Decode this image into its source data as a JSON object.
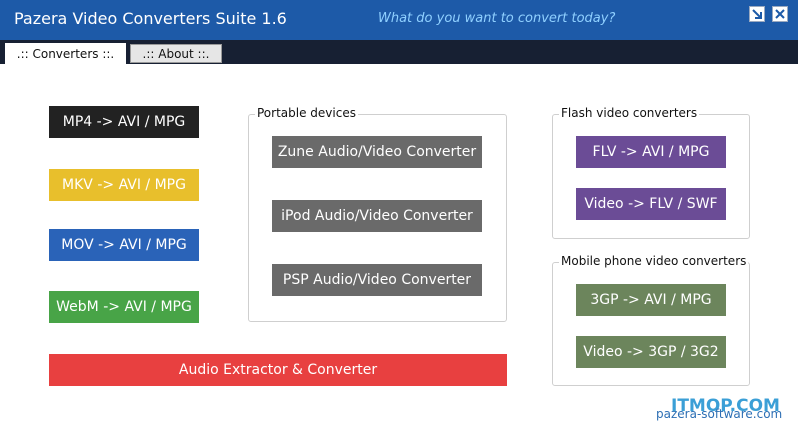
{
  "window": {
    "title": "Pazera Video Converters Suite 1.6",
    "tagline": "What do you want to convert today?",
    "controls": {
      "restore_icon": "restore-icon",
      "close_icon": "close-icon"
    }
  },
  "tabs": [
    {
      "label": ".:: Converters ::.",
      "active": true
    },
    {
      "label": ".:: About ::.",
      "active": false
    }
  ],
  "converters": {
    "mp4": "MP4 -> AVI / MPG",
    "mkv": "MKV -> AVI / MPG",
    "mov": "MOV -> AVI / MPG",
    "webm": "WebM -> AVI / MPG",
    "audio": "Audio Extractor & Converter"
  },
  "portable": {
    "label": "Portable devices",
    "zune": "Zune Audio/Video Converter",
    "ipod": "iPod Audio/Video Converter",
    "psp": "PSP Audio/Video Converter"
  },
  "flash": {
    "label": "Flash video converters",
    "flv": "FLV -> AVI / MPG",
    "video_flv": "Video -> FLV / SWF"
  },
  "mobile": {
    "label": "Mobile phone video converters",
    "three_gp": "3GP -> AVI / MPG",
    "video_3gp": "Video -> 3GP / 3G2"
  },
  "footer": {
    "link": "pazera-software.com"
  },
  "watermark": {
    "text": "ITMOP.COM"
  },
  "colors": {
    "titlebar": "#1d5aa8",
    "tabstrip": "#172033",
    "mp4": "#222222",
    "mkv": "#e8bf2c",
    "mov": "#2a63b8",
    "webm": "#48a447",
    "audio": "#e84040",
    "portable": "#6a6a6a",
    "flash": "#6b4c96",
    "mobile": "#6c855c"
  }
}
